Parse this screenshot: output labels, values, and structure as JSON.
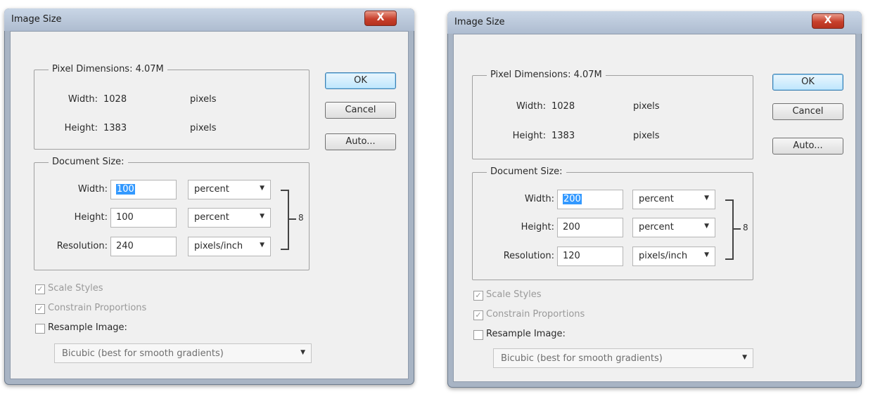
{
  "dialogs": [
    {
      "title": "Image Size",
      "close_glyph": "X",
      "pixel_dimensions": {
        "legend": "Pixel Dimensions:",
        "size": "4.07M",
        "width_label": "Width:",
        "width_value": "1028",
        "width_unit": "pixels",
        "height_label": "Height:",
        "height_value": "1383",
        "height_unit": "pixels"
      },
      "document_size": {
        "legend": "Document Size:",
        "width_label": "Width:",
        "width_value": "100",
        "width_unit": "percent",
        "height_label": "Height:",
        "height_value": "100",
        "height_unit": "percent",
        "resolution_label": "Resolution:",
        "resolution_value": "240",
        "resolution_unit": "pixels/inch"
      },
      "buttons": {
        "ok": "OK",
        "cancel": "Cancel",
        "auto": "Auto..."
      },
      "options": {
        "scale_styles": "Scale Styles",
        "constrain_proportions": "Constrain Proportions",
        "resample_image": "Resample Image:",
        "resample_method": "Bicubic (best for smooth gradients)"
      }
    },
    {
      "title": "Image Size",
      "close_glyph": "X",
      "pixel_dimensions": {
        "legend": "Pixel Dimensions:",
        "size": "4.07M",
        "width_label": "Width:",
        "width_value": "1028",
        "width_unit": "pixels",
        "height_label": "Height:",
        "height_value": "1383",
        "height_unit": "pixels"
      },
      "document_size": {
        "legend": "Document Size:",
        "width_label": "Width:",
        "width_value": "200",
        "width_unit": "percent",
        "height_label": "Height:",
        "height_value": "200",
        "height_unit": "percent",
        "resolution_label": "Resolution:",
        "resolution_value": "120",
        "resolution_unit": "pixels/inch"
      },
      "buttons": {
        "ok": "OK",
        "cancel": "Cancel",
        "auto": "Auto..."
      },
      "options": {
        "scale_styles": "Scale Styles",
        "constrain_proportions": "Constrain Proportions",
        "resample_image": "Resample Image:",
        "resample_method": "Bicubic (best for smooth gradients)"
      }
    }
  ]
}
